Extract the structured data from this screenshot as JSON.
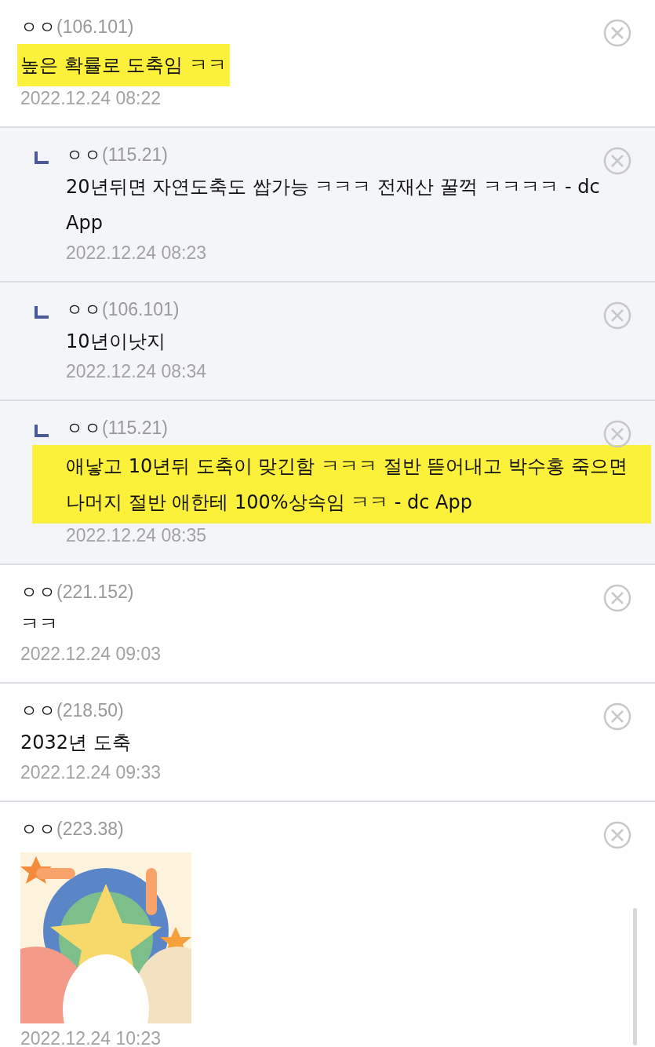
{
  "comments": [
    {
      "kind": "comment",
      "name": "ㅇㅇ",
      "ip": "(106.101)",
      "text": "높은 확률로 도축임 ㅋㅋ",
      "highlighted": true,
      "date": "2022.12.24 08:22"
    },
    {
      "kind": "reply",
      "name": "ㅇㅇ",
      "ip": "(115.21)",
      "text": "20년뒤면 자연도축도 쌉가능 ㅋㅋㅋ 전재산 꿀꺽 ㅋㅋㅋㅋ - dc App",
      "highlighted": false,
      "date": "2022.12.24 08:23"
    },
    {
      "kind": "reply",
      "name": "ㅇㅇ",
      "ip": "(106.101)",
      "text": "10년이낫지",
      "highlighted": false,
      "date": "2022.12.24 08:34"
    },
    {
      "kind": "reply",
      "name": "ㅇㅇ",
      "ip": "(115.21)",
      "text": "애낳고 10년뒤 도축이 맞긴함 ㅋㅋㅋ 절반 뜯어내고 박수홍 죽으면 나머지 절반 애한테 100%상속임 ㅋㅋ - dc App",
      "highlighted": true,
      "date": "2022.12.24 08:35"
    },
    {
      "kind": "comment",
      "name": "ㅇㅇ",
      "ip": "(221.152)",
      "text": "ㅋㅋ",
      "highlighted": false,
      "date": "2022.12.24 09:03"
    },
    {
      "kind": "comment",
      "name": "ㅇㅇ",
      "ip": "(218.50)",
      "text": "2032년 도축",
      "highlighted": false,
      "date": "2022.12.24 09:33"
    },
    {
      "kind": "comment",
      "name": "ㅇㅇ",
      "ip": "(223.38)",
      "date": "2022.12.24 10:23"
    }
  ]
}
